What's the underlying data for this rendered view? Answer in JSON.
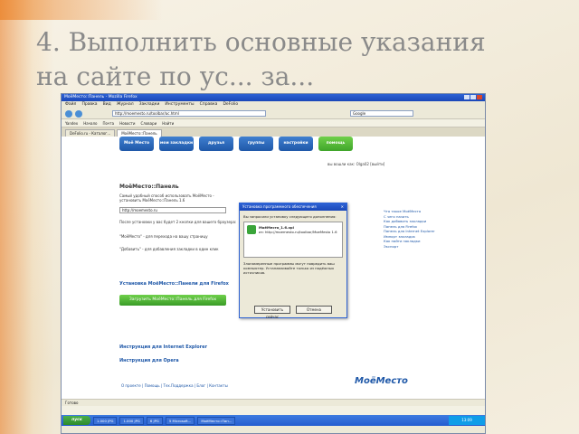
{
  "slide": {
    "title": "4. Выполнить основные указания на сайте по ус... за..."
  },
  "browser": {
    "window_title": "МоёМесто::Панель - Mozilla Firefox",
    "menu": [
      "Файл",
      "Правка",
      "Вид",
      "Журнал",
      "Закладки",
      "Инструменты",
      "Справка",
      "DeFolio"
    ],
    "url": "http://moemesto.ru/toolbar/ac.html",
    "search_placeholder": "Google",
    "toolbar_items": [
      "Yandex",
      "Начало",
      "Почта",
      "Новости",
      "Словари",
      "Найти"
    ],
    "tabs": [
      "DeFolio.ru - Каталог...",
      "МоёМесто::Панель",
      ""
    ],
    "status": "Готово"
  },
  "site": {
    "nav": [
      "Моё Место",
      "мои закладки",
      "друзья",
      "группы",
      "настройки",
      "помощь"
    ],
    "user": "вы вошли как: Olga02 [выйти]",
    "heading": "МоёМесто::Панель",
    "intro": "Самый удобный способ использовать МоёМесто - установить МоёМесто::Панель 1.6",
    "input_value": "http://moemesto.ru",
    "text_after_input": "После установки у вас будет 2 кнопки для вашего браузера:",
    "items": [
      "\"МоёМесто\" - для перехода на вашу страницу",
      "\"Добавить\" - для добавления закладки в один клик"
    ],
    "install_title": "Установка МоёМесто::Панели для Firefox",
    "install_button": "Загрузить МоёМесто::Панель для Firefox",
    "links": [
      "Инструкция для Internet Explorer",
      "Инструкция для Opera"
    ],
    "right_col": [
      "Что такое МоёМесто",
      "С чего начать",
      "Как добавить закладки",
      "Панель для Firefox",
      "Панель для Internet Explorer",
      "Импорт закладок",
      "Как найти закладки",
      "Экспорт"
    ],
    "footer": "О проекте | Помощь | Тех.Поддержка | Блог | Контакты",
    "logo": "МоёМесто"
  },
  "dialog": {
    "title": "Установка программного обеспечения",
    "intro": "Вы запросили установку следующего дополнения:",
    "item_name": "МоёМесто_1.6.xpi",
    "item_from": "из: http://moemesto.ru/toolbar/MoeMesto 1.6",
    "warning": "Злонамеренные программы могут повредить ваш компьютер. Устанавливайте только из надёжных источников.",
    "install_button": "Установить сейчас",
    "cancel_button": "Отмена"
  },
  "taskbar": {
    "start": "пуск",
    "items": [
      "1.000 JPG",
      "1.000 JPG",
      "6 JPG",
      "...",
      "5 Microsoft...",
      "МоёМесто::Пан..."
    ],
    "tray": "13:09"
  }
}
